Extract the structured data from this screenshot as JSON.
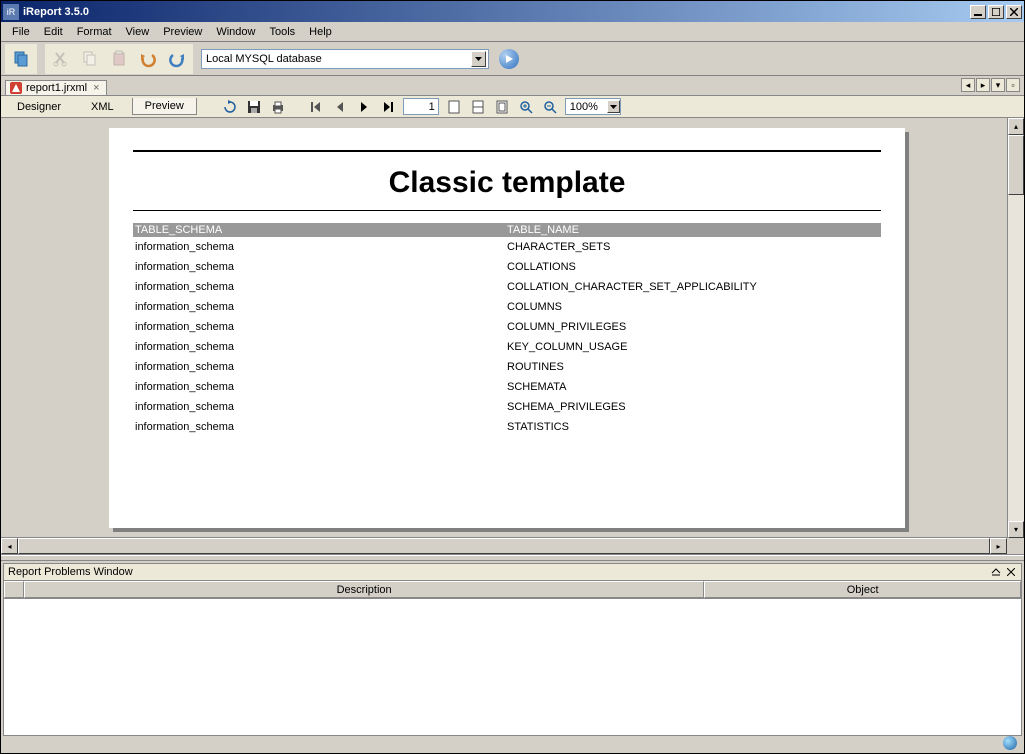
{
  "window": {
    "title": "iReport 3.5.0"
  },
  "menu": {
    "items": [
      "File",
      "Edit",
      "Format",
      "View",
      "Preview",
      "Window",
      "Tools",
      "Help"
    ]
  },
  "toolbar": {
    "datasource": "Local MYSQL database"
  },
  "tab": {
    "filename": "report1.jrxml"
  },
  "viewtabs": {
    "designer": "Designer",
    "xml": "XML",
    "preview": "Preview"
  },
  "preview_toolbar": {
    "page": "1",
    "zoom": "100%"
  },
  "report": {
    "title": "Classic template",
    "col_headers": {
      "c1": "TABLE_SCHEMA",
      "c2": "TABLE_NAME"
    },
    "rows": [
      {
        "c1": "information_schema",
        "c2": "CHARACTER_SETS"
      },
      {
        "c1": "information_schema",
        "c2": "COLLATIONS"
      },
      {
        "c1": "information_schema",
        "c2": "COLLATION_CHARACTER_SET_APPLICABILITY"
      },
      {
        "c1": "information_schema",
        "c2": "COLUMNS"
      },
      {
        "c1": "information_schema",
        "c2": "COLUMN_PRIVILEGES"
      },
      {
        "c1": "information_schema",
        "c2": "KEY_COLUMN_USAGE"
      },
      {
        "c1": "information_schema",
        "c2": "ROUTINES"
      },
      {
        "c1": "information_schema",
        "c2": "SCHEMATA"
      },
      {
        "c1": "information_schema",
        "c2": "SCHEMA_PRIVILEGES"
      },
      {
        "c1": "information_schema",
        "c2": "STATISTICS"
      }
    ]
  },
  "problems_panel": {
    "title": "Report Problems Window",
    "col_desc": "Description",
    "col_obj": "Object"
  }
}
